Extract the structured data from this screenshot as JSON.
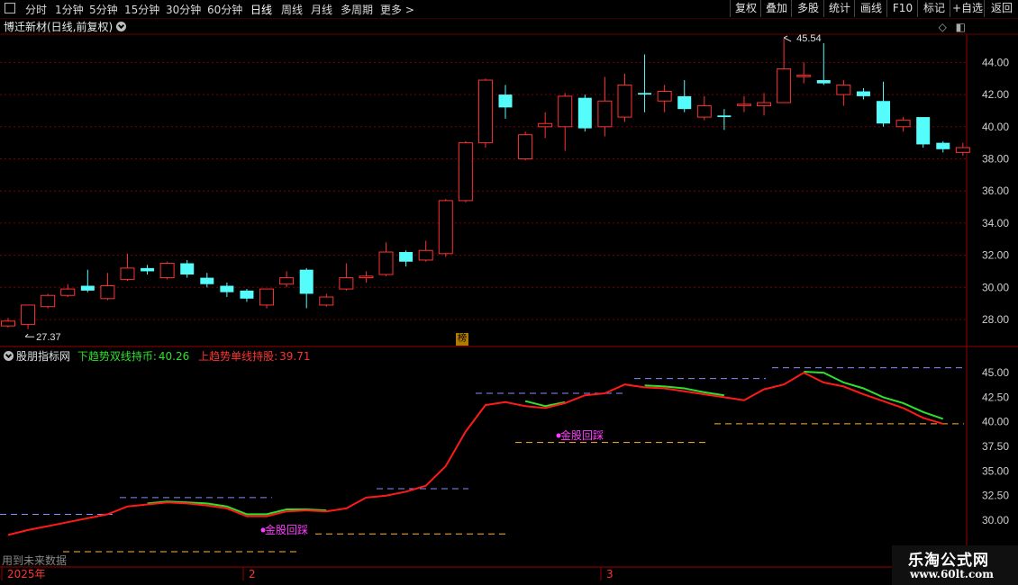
{
  "toolbar": {
    "periods": [
      "分时",
      "1分钟",
      "5分钟",
      "15分钟",
      "30分钟",
      "60分钟",
      "日线",
      "周线",
      "月线",
      "多周期",
      "更多 >"
    ],
    "active_period": "日线",
    "right_buttons": [
      "复权",
      "叠加",
      "多股",
      "统计",
      "画线",
      "F10",
      "标记",
      "+自选",
      "返回"
    ]
  },
  "stock": {
    "title": "博迁新材(日线,前复权)"
  },
  "main_chart": {
    "price_axis": [
      "44.00",
      "42.00",
      "40.00",
      "38.00",
      "36.00",
      "34.00",
      "32.00",
      "30.00",
      "28.00"
    ],
    "high_label": "45.54",
    "low_label": "27.37",
    "badge": "榜",
    "candles": [
      [
        27.6,
        27.9,
        27.5,
        28.1
      ],
      [
        27.7,
        28.9,
        27.4,
        28.9
      ],
      [
        28.8,
        29.5,
        28.7,
        29.6
      ],
      [
        29.5,
        29.9,
        29.4,
        30.2
      ],
      [
        30.1,
        29.8,
        29.7,
        31.1
      ],
      [
        29.3,
        30.1,
        29.2,
        30.9
      ],
      [
        30.5,
        31.2,
        30.4,
        32.1
      ],
      [
        31.2,
        31.0,
        30.8,
        31.4
      ],
      [
        30.6,
        31.5,
        30.5,
        31.6
      ],
      [
        31.5,
        30.8,
        30.6,
        31.7
      ],
      [
        30.6,
        30.2,
        30.0,
        30.9
      ],
      [
        30.1,
        29.7,
        29.4,
        30.3
      ],
      [
        29.8,
        29.3,
        29.1,
        29.9
      ],
      [
        28.9,
        29.9,
        28.7,
        29.9
      ],
      [
        30.2,
        30.6,
        30.0,
        31.0
      ],
      [
        31.1,
        29.6,
        28.7,
        31.2
      ],
      [
        28.9,
        29.4,
        28.8,
        29.6
      ],
      [
        29.9,
        30.6,
        29.8,
        31.5
      ],
      [
        30.6,
        30.7,
        30.3,
        31.0
      ],
      [
        30.8,
        32.2,
        30.7,
        32.8
      ],
      [
        32.2,
        31.6,
        31.3,
        32.3
      ],
      [
        31.7,
        32.3,
        31.6,
        32.9
      ],
      [
        32.1,
        35.4,
        31.9,
        35.5
      ],
      [
        35.4,
        39.0,
        35.3,
        39.1
      ],
      [
        39.0,
        42.9,
        38.7,
        43.0
      ],
      [
        42.0,
        41.2,
        40.5,
        42.6
      ],
      [
        38.0,
        39.5,
        37.9,
        39.7
      ],
      [
        40.0,
        40.2,
        39.3,
        40.9
      ],
      [
        40.0,
        41.9,
        38.5,
        42.1
      ],
      [
        41.8,
        39.9,
        39.7,
        42.0
      ],
      [
        40.0,
        41.6,
        39.4,
        43.1
      ],
      [
        40.6,
        42.6,
        40.3,
        43.3
      ],
      [
        42.1,
        42.0,
        40.9,
        44.5
      ],
      [
        41.6,
        42.2,
        40.9,
        42.6
      ],
      [
        41.9,
        41.1,
        40.9,
        42.9
      ],
      [
        40.6,
        41.3,
        40.4,
        41.9
      ],
      [
        40.7,
        40.6,
        39.8,
        41.1
      ],
      [
        41.4,
        41.4,
        40.9,
        41.9
      ],
      [
        41.3,
        41.5,
        40.7,
        42.1
      ],
      [
        41.5,
        43.6,
        41.5,
        45.5
      ],
      [
        43.2,
        43.2,
        42.7,
        44.0
      ],
      [
        42.9,
        42.7,
        42.6,
        45.2
      ],
      [
        42.0,
        42.6,
        41.3,
        42.9
      ],
      [
        42.2,
        41.9,
        41.7,
        42.4
      ],
      [
        41.6,
        40.2,
        40.0,
        42.8
      ],
      [
        40.0,
        40.4,
        39.7,
        40.6
      ],
      [
        40.6,
        38.9,
        38.7,
        40.6
      ],
      [
        39.0,
        38.6,
        38.4,
        39.1
      ],
      [
        38.4,
        38.7,
        38.2,
        39.0
      ]
    ]
  },
  "indicator": {
    "name": "股朋指标网",
    "down_label": "下趋势双线持币:",
    "down_value": "40.26",
    "up_label": "上趋势单线持股:",
    "up_value": "39.71",
    "axis": [
      "45.00",
      "42.50",
      "40.00",
      "37.50",
      "35.00",
      "32.50",
      "30.00"
    ],
    "signal_label": "金股回踩",
    "future_note": "用到未来数据",
    "red_line": [
      28.5,
      29.0,
      29.4,
      29.8,
      30.2,
      30.6,
      31.4,
      31.6,
      31.8,
      31.7,
      31.5,
      31.2,
      30.4,
      30.4,
      30.9,
      31.0,
      30.9,
      31.2,
      32.3,
      32.5,
      32.9,
      33.5,
      35.5,
      39.0,
      41.7,
      42.0,
      41.6,
      41.4,
      41.9,
      42.7,
      42.9,
      43.8,
      43.5,
      43.4,
      43.1,
      42.8,
      42.5,
      42.2,
      43.3,
      43.8,
      45.0,
      44.0,
      43.6,
      42.8,
      42.1,
      41.4,
      40.4,
      39.8
    ],
    "green_line": [
      null,
      null,
      null,
      null,
      null,
      null,
      null,
      31.7,
      31.9,
      31.8,
      31.7,
      31.4,
      30.6,
      30.6,
      31.1,
      31.1,
      31.0,
      null,
      null,
      null,
      null,
      null,
      null,
      null,
      null,
      null,
      42.1,
      41.6,
      42.0,
      null,
      null,
      null,
      43.7,
      43.6,
      43.4,
      43.0,
      42.7,
      null,
      null,
      null,
      45.1,
      45.0,
      44.0,
      43.4,
      42.5,
      41.9,
      41.0,
      40.3
    ]
  },
  "time_axis": [
    "2025年",
    "2",
    "3"
  ],
  "watermark": {
    "line1": "乐淘公式网",
    "line2": "www.60lt.com"
  },
  "colors": {
    "bull": "#ff3232",
    "bear": "#54fcfc",
    "grid": "#7a0000",
    "green_line": "#2ee02e",
    "red_line": "#ff1a1a",
    "signal": "#ff3cff"
  }
}
